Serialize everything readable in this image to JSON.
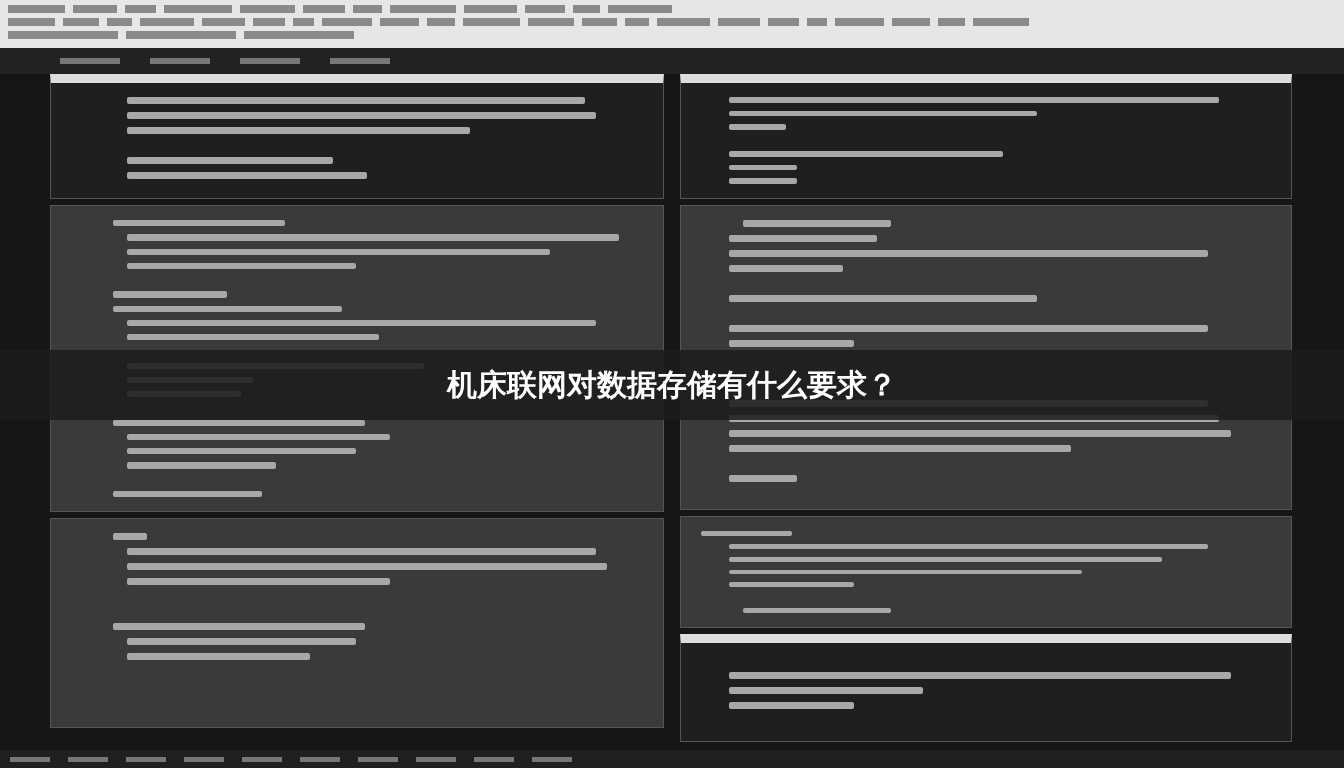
{
  "banner": {
    "title": "机床联网对数据存储有什么要求？"
  }
}
